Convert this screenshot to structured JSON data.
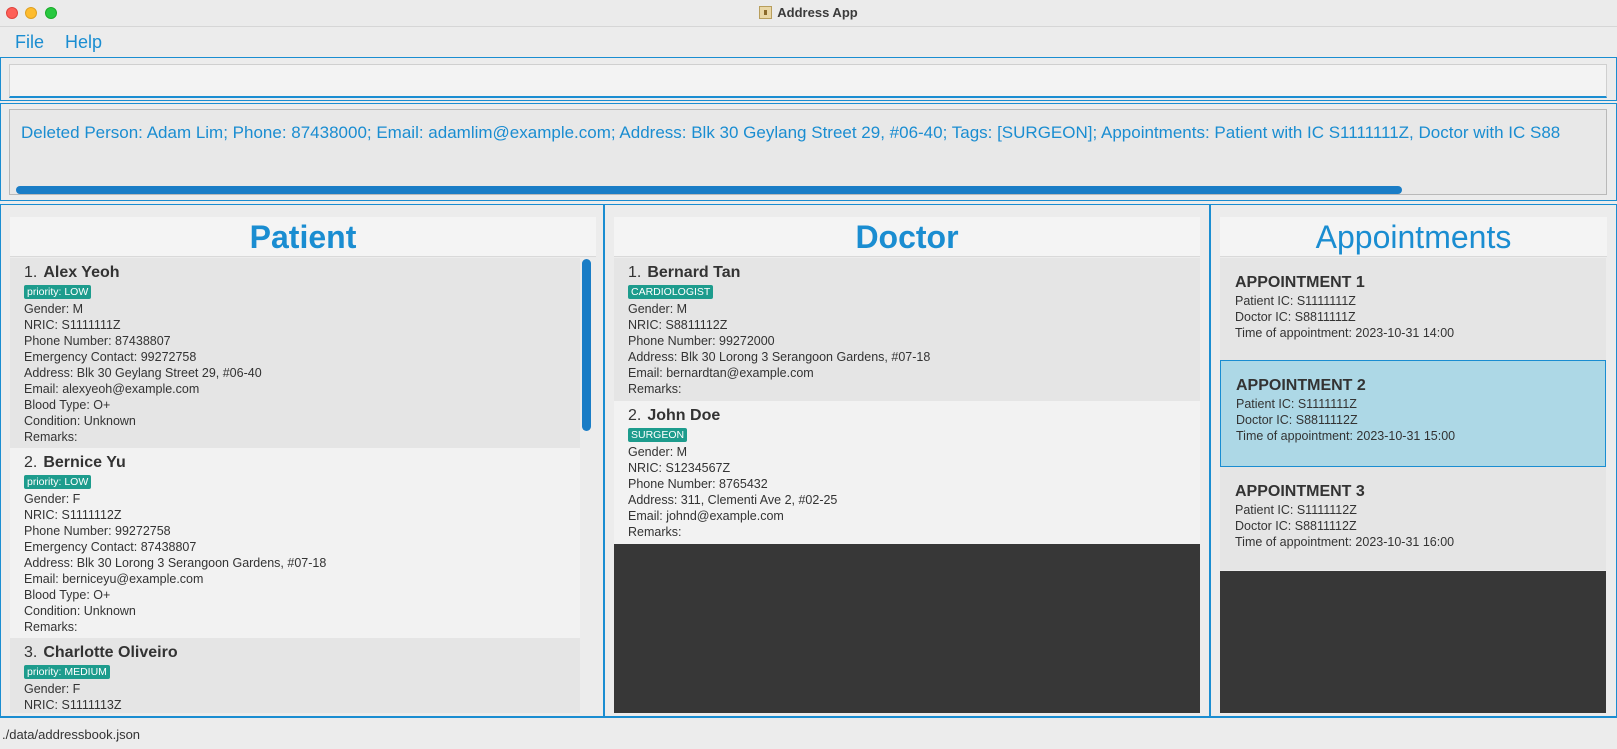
{
  "window": {
    "title": "Address App",
    "icon": "address-book-icon"
  },
  "menu": {
    "file": "File",
    "help": "Help"
  },
  "command": {
    "value": ""
  },
  "result": {
    "text": "Deleted Person: Adam Lim; Phone: 87438000; Email: adamlim@example.com; Address: Blk 30 Geylang Street 29, #06-40; Tags: [SURGEON]; Appointments: Patient with IC S1111111Z, Doctor with IC S88"
  },
  "patients": {
    "header": "Patient",
    "items": [
      {
        "index": "1.",
        "name": "Alex Yeoh",
        "tag": "priority: LOW",
        "gender": "Gender: M",
        "nric": "NRIC: S1111111Z",
        "phone": "Phone Number: 87438807",
        "emergency": "Emergency Contact: 99272758",
        "address": "Address: Blk 30 Geylang Street 29, #06-40",
        "email": "Email: alexyeoh@example.com",
        "blood": "Blood Type: O+",
        "condition": "Condition: Unknown",
        "remarks": "Remarks:"
      },
      {
        "index": "2.",
        "name": "Bernice Yu",
        "tag": "priority: LOW",
        "gender": "Gender: F",
        "nric": "NRIC: S1111112Z",
        "phone": "Phone Number: 99272758",
        "emergency": "Emergency Contact: 87438807",
        "address": "Address: Blk 30 Lorong 3 Serangoon Gardens, #07-18",
        "email": "Email: berniceyu@example.com",
        "blood": "Blood Type: O+",
        "condition": "Condition: Unknown",
        "remarks": "Remarks:"
      },
      {
        "index": "3.",
        "name": "Charlotte Oliveiro",
        "tag": "priority: MEDIUM",
        "gender": "Gender: F",
        "nric": "NRIC: S1111113Z"
      }
    ]
  },
  "doctors": {
    "header": "Doctor",
    "items": [
      {
        "index": "1.",
        "name": "Bernard Tan",
        "tag": "CARDIOLOGIST",
        "gender": "Gender: M",
        "nric": "NRIC: S8811112Z",
        "phone": "Phone Number: 99272000",
        "address": "Address: Blk 30 Lorong 3 Serangoon Gardens, #07-18",
        "email": "Email: bernardtan@example.com",
        "remarks": "Remarks:"
      },
      {
        "index": "2.",
        "name": "John Doe",
        "tag": "SURGEON",
        "gender": "Gender: M",
        "nric": "NRIC: S1234567Z",
        "phone": "Phone Number: 8765432",
        "address": "Address: 311, Clementi Ave 2, #02-25",
        "email": "Email: johnd@example.com",
        "remarks": "Remarks:"
      }
    ]
  },
  "appointments": {
    "header": "Appointments",
    "items": [
      {
        "title": "APPOINTMENT 1",
        "patient": "Patient IC: S1111111Z",
        "doctor": "Doctor IC: S8811111Z",
        "time": "Time of appointment: 2023-10-31 14:00"
      },
      {
        "title": "APPOINTMENT 2",
        "patient": "Patient IC: S1111111Z",
        "doctor": "Doctor IC: S8811112Z",
        "time": "Time of appointment: 2023-10-31 15:00"
      },
      {
        "title": "APPOINTMENT 3",
        "patient": "Patient IC: S1111112Z",
        "doctor": "Doctor IC: S8811112Z",
        "time": "Time of appointment: 2023-10-31 16:00"
      }
    ]
  },
  "status": {
    "path": "./data/addressbook.json"
  },
  "colors": {
    "accent": "#1a8dd1",
    "tag": "#1d9c8d",
    "selected": "#add8e6",
    "empty_fill": "#373737"
  }
}
